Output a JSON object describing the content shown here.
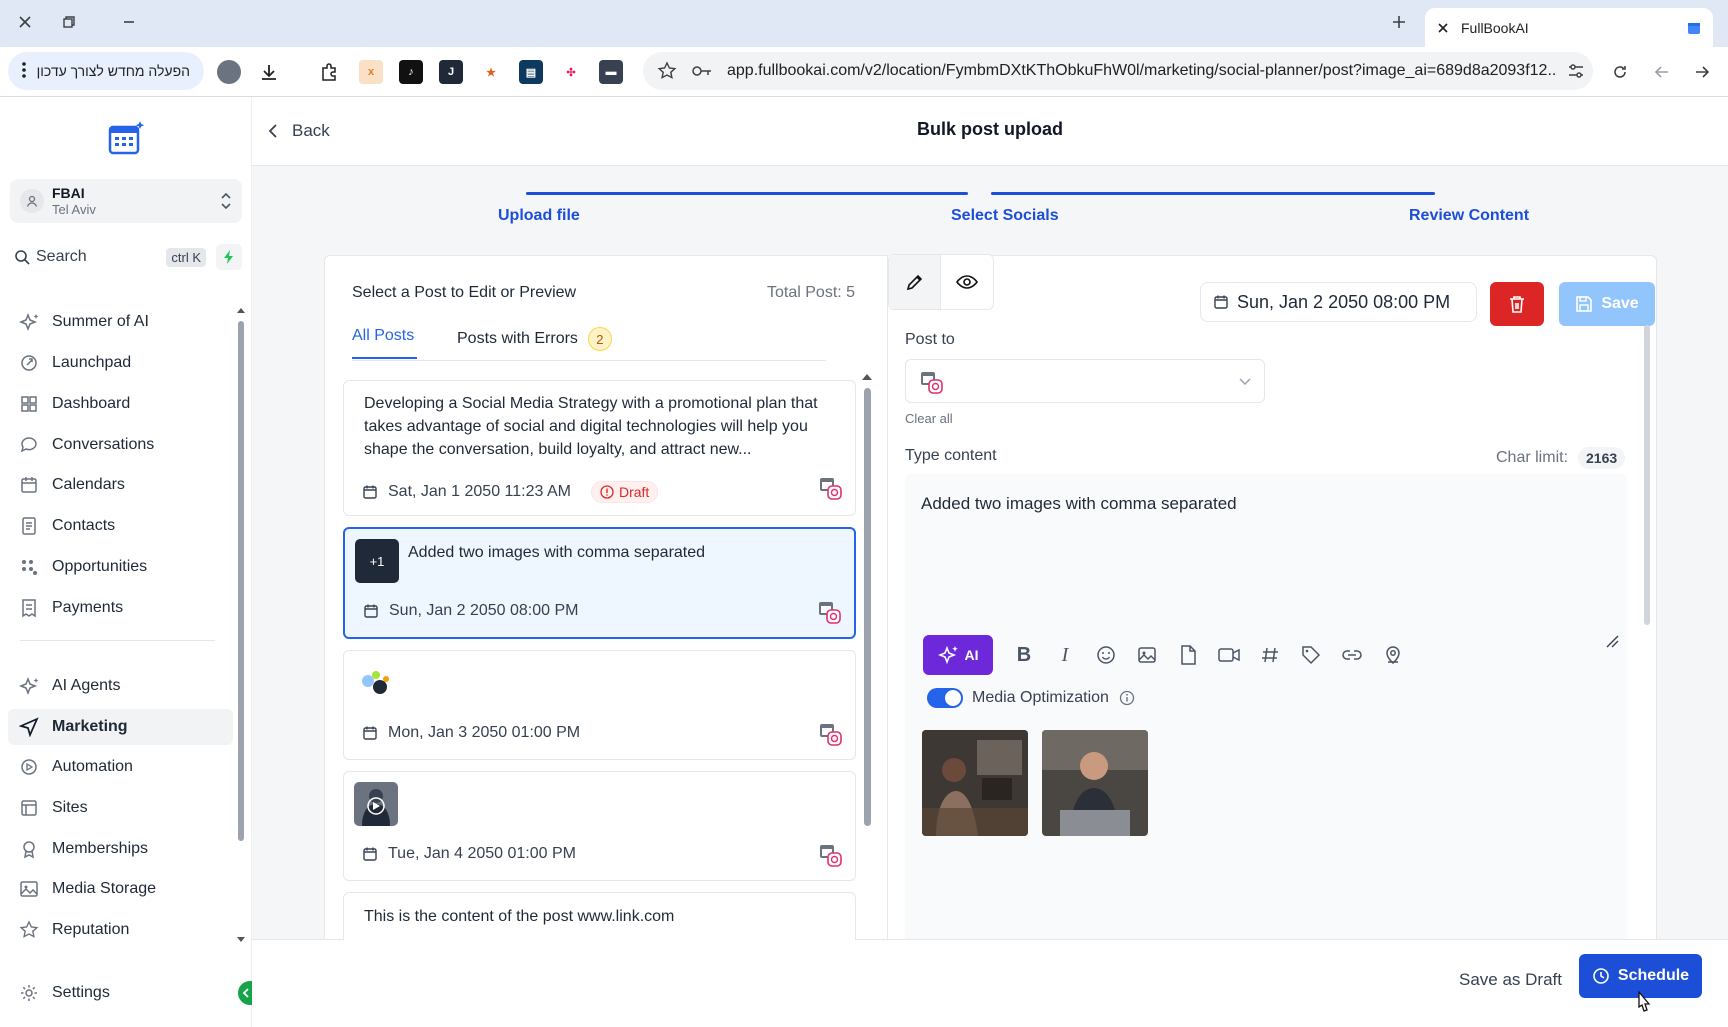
{
  "browser": {
    "tab_title": "FullBookAI",
    "url": "app.fullbookai.com/v2/location/FymbmDXtKThObkuFhW0l/marketing/social-planner/post?image_ai=689d8a2093f12...",
    "update_pill": "הפעלה מחדש לצורך עדכון"
  },
  "sidebar": {
    "location_name": "FBAI",
    "location_city": "Tel Aviv",
    "search_placeholder": "Search",
    "search_shortcut": "ctrl K",
    "items": [
      {
        "label": "Summer of AI",
        "icon": "sparkle-icon"
      },
      {
        "label": "Launchpad",
        "icon": "rocket-icon"
      },
      {
        "label": "Dashboard",
        "icon": "grid-icon"
      },
      {
        "label": "Conversations",
        "icon": "chat-icon"
      },
      {
        "label": "Calendars",
        "icon": "calendar-icon"
      },
      {
        "label": "Contacts",
        "icon": "contacts-icon"
      },
      {
        "label": "Opportunities",
        "icon": "opportunities-icon"
      },
      {
        "label": "Payments",
        "icon": "receipt-icon"
      },
      {
        "label": "AI Agents",
        "icon": "sparkle-icon"
      },
      {
        "label": "Marketing",
        "icon": "send-icon"
      },
      {
        "label": "Automation",
        "icon": "automation-icon"
      },
      {
        "label": "Sites",
        "icon": "sites-icon"
      },
      {
        "label": "Memberships",
        "icon": "award-icon"
      },
      {
        "label": "Media Storage",
        "icon": "image-icon"
      },
      {
        "label": "Reputation",
        "icon": "star-icon"
      }
    ],
    "settings_label": "Settings"
  },
  "header": {
    "back_label": "Back",
    "title": "Bulk post upload"
  },
  "steps": [
    {
      "label": "Upload file"
    },
    {
      "label": "Select Socials"
    },
    {
      "label": "Review Content"
    }
  ],
  "post_list": {
    "heading": "Select a Post to Edit or Preview",
    "total": "Total Post: 5",
    "tabs": {
      "all": "All Posts",
      "errors": "Posts with Errors",
      "errors_count": "2"
    },
    "posts": [
      {
        "text": "Developing a Social Media Strategy with a promotional plan that takes advantage of social and digital technologies will help you shape the conversation, build loyalty, and attract new...",
        "date": "Sat, Jan 1 2050 11:23 AM",
        "badge": "Draft"
      },
      {
        "text": "Added two images with comma separated",
        "date": "Sun, Jan 2 2050 08:00 PM",
        "thumb_badge": "+1"
      },
      {
        "text": "",
        "date": "Mon, Jan 3 2050 01:00 PM"
      },
      {
        "text": "",
        "date": "Tue, Jan 4 2050 01:00 PM"
      },
      {
        "text": "This is the content of the post www.link.com",
        "date": ""
      }
    ]
  },
  "editor": {
    "date": "Sun, Jan 2 2050 08:00 PM",
    "save_label": "Save",
    "post_to_label": "Post to",
    "clear_all": "Clear all",
    "type_content_label": "Type content",
    "char_limit_label": "Char limit:",
    "char_limit_value": "2163",
    "content": "Added two images with comma separated",
    "ai_label": "AI",
    "media_optimization": "Media Optimization"
  },
  "footer": {
    "save_draft": "Save as Draft",
    "schedule": "Schedule"
  },
  "colors": {
    "accent": "#1d4ed8",
    "delete": "#dc2626",
    "save_disabled": "#93c5fd",
    "ai": "#6d28d9"
  }
}
